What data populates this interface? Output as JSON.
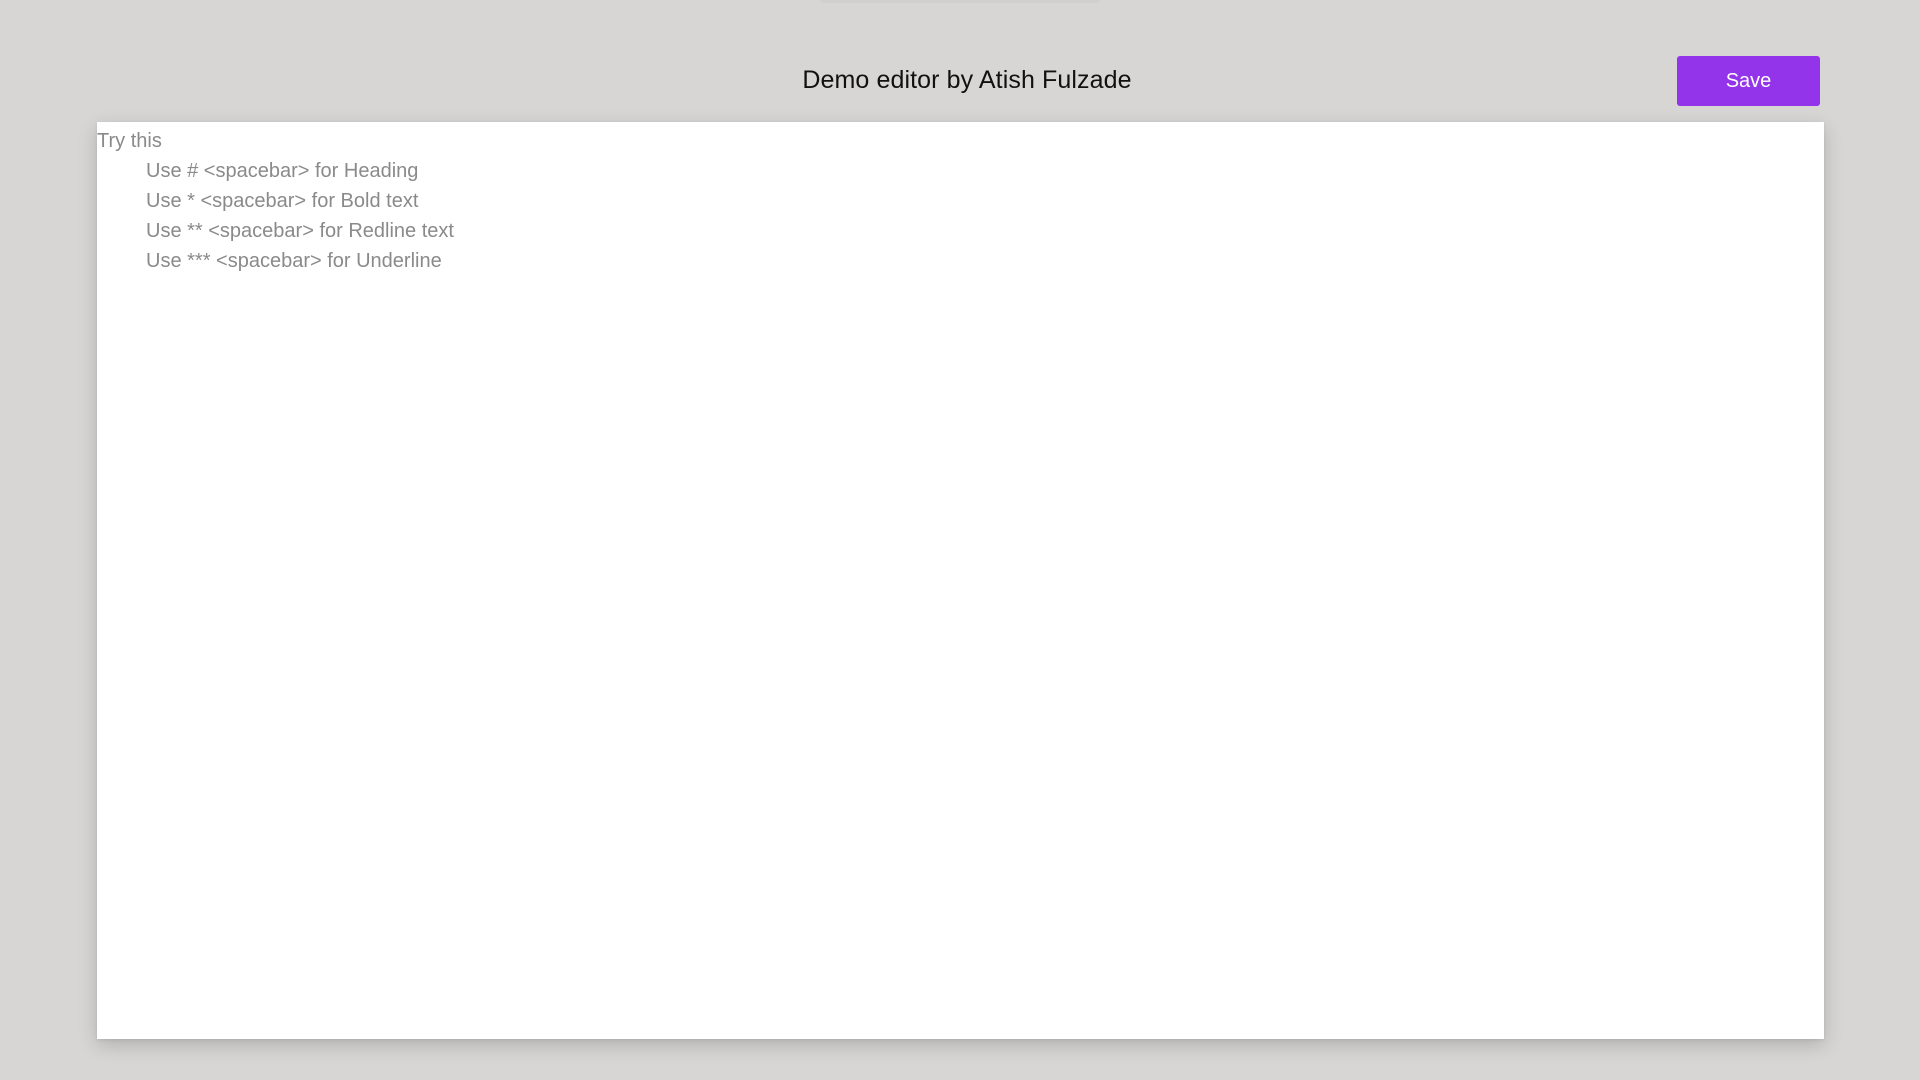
{
  "header": {
    "title": "Demo editor by Atish Fulzade",
    "save_label": "Save"
  },
  "editor": {
    "hint_heading": "Try this",
    "hints": [
      "Use # <spacebar> for Heading",
      "Use * <spacebar> for Bold text",
      "Use ** <spacebar> for Redline text",
      "Use *** <spacebar> for Underline"
    ]
  },
  "colors": {
    "background": "#d8d6d5",
    "accent": "#9333ea",
    "editor_background": "#ffffff",
    "hint_text": "#8a8a8a"
  }
}
